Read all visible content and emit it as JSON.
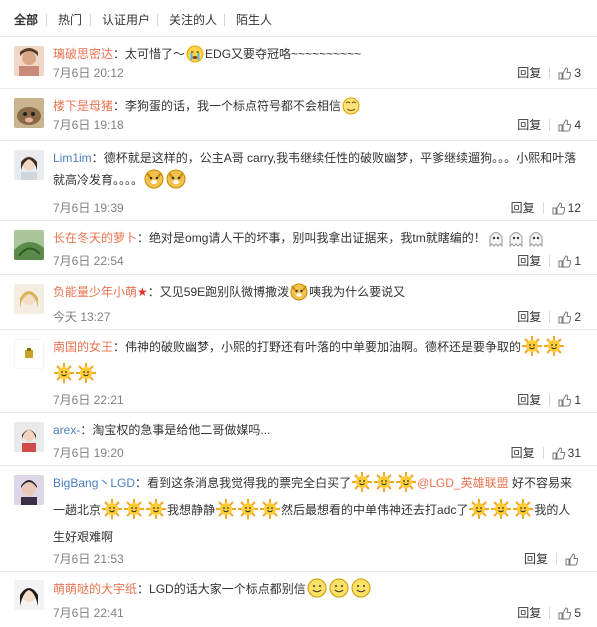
{
  "tabs": [
    "全部",
    "热门",
    "认证用户",
    "关注的人",
    "陌生人"
  ],
  "colors": {
    "name_orange": "#eb7350",
    "name_blue": "#4a7fbd",
    "meta_gray": "#808080",
    "border": "#eaeaea"
  },
  "comments": [
    {
      "name": "璃破思密达",
      "parts": [
        "太可惜了～",
        "EDG又要夺冠咯~~~~~~~~~~"
      ],
      "time": "7月6日 20:12",
      "reply": "回复",
      "likes": "3"
    },
    {
      "name": "楼下是母猪",
      "parts": [
        "李狗蛋的话，我一个标点符号都不会相信"
      ],
      "time": "7月6日 19:18",
      "reply": "回复",
      "likes": "4"
    },
    {
      "name": "Lim1im",
      "parts": [
        "德杯就是这样的，公主A哥 carry,我韦继续任性的破败幽梦，平爹继续遛狗。。。小熙和叶落就高冷发育。。。。"
      ],
      "time": "7月6日 19:39",
      "reply": "回复",
      "likes": "12"
    },
    {
      "name": "长在冬天的萝卜",
      "parts": [
        "绝对是omg请人干的坏事，别叫我拿出证据来，我tm就瞎编的！"
      ],
      "time": "7月6日 22:54",
      "reply": "回复",
      "likes": "1"
    },
    {
      "name": "负能量少年小萌",
      "parts": [
        "又见59E跑别队微博撒泼",
        "咦我为什么要说又"
      ],
      "time": "今天 13:27",
      "reply": "回复",
      "likes": "2"
    },
    {
      "name": "南国的女王",
      "parts": [
        "伟神的破败幽梦，小熙的打野还有叶落的中单要加油啊。德杯还是要争取的"
      ],
      "time": "7月6日 22:21",
      "reply": "回复",
      "likes": "1"
    },
    {
      "name": "arex-",
      "parts": [
        "淘宝权的急事是给他二哥做媒吗..."
      ],
      "time": "7月6日 19:20",
      "reply": "回复",
      "likes": "31"
    },
    {
      "name": "BigBang丶LGD",
      "parts": [
        "看到这条消息我觉得我的票完全白买了",
        "@LGD_英雄联盟",
        "好不容易来一趟北京",
        "我想静静",
        "然后最想看的中单伟神还去打adc了",
        "我的人生好艰难啊"
      ],
      "time": "7月6日 21:53",
      "reply": "回复",
      "likes": ""
    },
    {
      "name": "萌萌哒的大宇纸",
      "parts": [
        "LGD的话大家一个标点都别信"
      ],
      "time": "7月6日 22:41",
      "reply": "回复",
      "likes": "5"
    }
  ]
}
